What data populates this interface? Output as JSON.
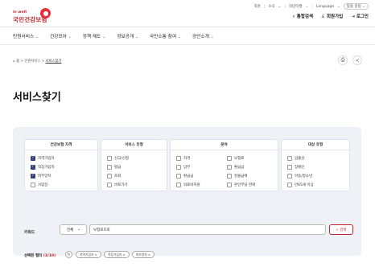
{
  "util": {
    "links": [
      "직원",
      "소식",
      "희망티켓",
      "Language",
      "맞춤 알림"
    ]
  },
  "logo": {
    "small": "in welt",
    "main": "국민건강보험"
  },
  "header": {
    "search_label": "통합검색",
    "join_label": "회원가입",
    "login_label": "로그인"
  },
  "gnb": [
    {
      "label": "민원서비스"
    },
    {
      "label": "건강모아"
    },
    {
      "label": "정책·제도"
    },
    {
      "label": "정보공개"
    },
    {
      "label": "국민소통·참여"
    },
    {
      "label": "공단소개"
    }
  ],
  "breadcrumb": {
    "home": "홈",
    "level1": "민원서비스",
    "current": "서비스찾기"
  },
  "page_title": "서비스찾기",
  "filters": {
    "qualification": {
      "title": "건강보험 자격",
      "options": [
        {
          "label": "지역가입자",
          "checked": true
        },
        {
          "label": "직장가입자",
          "checked": true
        },
        {
          "label": "피부양자",
          "checked": true
        },
        {
          "label": "사업장",
          "checked": false
        }
      ]
    },
    "service_type": {
      "title": "서비스 유형",
      "options": [
        {
          "label": "신고/신청",
          "checked": false
        },
        {
          "label": "발급",
          "checked": false
        },
        {
          "label": "조회",
          "checked": false
        },
        {
          "label": "바로가기",
          "checked": false
        }
      ]
    },
    "field": {
      "title": "분야",
      "options": [
        {
          "label": "자격",
          "checked": false
        },
        {
          "label": "납부",
          "checked": false
        },
        {
          "label": "환급금",
          "checked": false
        },
        {
          "label": "의료비지원",
          "checked": false
        },
        {
          "label": "보험료",
          "checked": false
        },
        {
          "label": "환급금",
          "checked": false
        },
        {
          "label": "현물급여",
          "checked": false
        },
        {
          "label": "본인부담 완화",
          "checked": false
        }
      ]
    },
    "target": {
      "title": "대상 유형",
      "options": [
        {
          "label": "임출산",
          "checked": false
        },
        {
          "label": "장애인",
          "checked": false
        },
        {
          "label": "아동/청소년",
          "checked": false
        },
        {
          "label": "만65세 이상",
          "checked": false
        }
      ]
    }
  },
  "keyword": {
    "label": "키워드",
    "scope": "전체",
    "value": "보험료조회",
    "button": "검색"
  },
  "selected": {
    "label": "선택된 필터",
    "count": "(3/10)",
    "chips": [
      "지역가입자 ×",
      "직장가입자 ×",
      "피부양자 ×"
    ]
  }
}
